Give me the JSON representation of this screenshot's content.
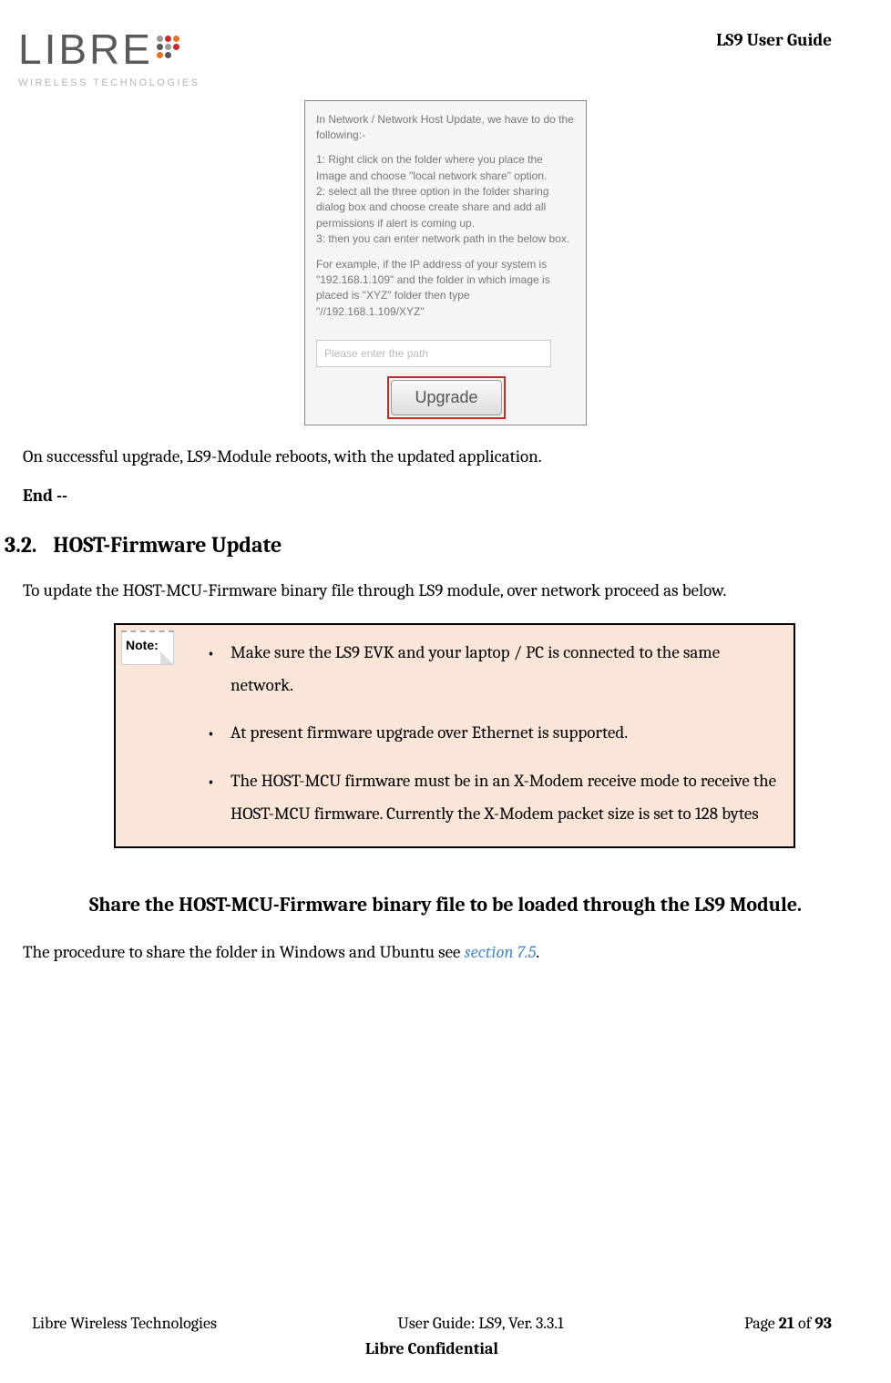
{
  "logo": {
    "text": "LIBRE",
    "subtitle": "WIRELESS TECHNOLOGIES"
  },
  "header": {
    "doc_title": "LS9 User Guide"
  },
  "dialog": {
    "intro": "In Network / Network Host Update, we have to do the following:-",
    "step1": "1: Right click on the folder where you place the Image and choose \"local network share\" option.",
    "step2": "2: select all the three option in the folder sharing dialog box and choose create share and add all permissions if alert is coming up.",
    "step3": "3: then you can enter network path in the below box.",
    "example": "For example, if the IP address of your system is \"192.168.1.109\" and the folder in which image is placed is \"XYZ\" folder then type \"//192.168.1.109/XYZ\"",
    "placeholder": "Please enter the path",
    "upgrade_button": "Upgrade"
  },
  "body": {
    "success_para": "On successful upgrade, LS9-Module reboots, with the updated application.",
    "end_label": "End --",
    "section_num": "3.2.",
    "section_title": "HOST-Firmware Update",
    "section_intro": "To update the HOST-MCU-Firmware binary file through LS9 module, over network proceed as below.",
    "note_label": "Note:",
    "notes": [
      "Make sure the LS9 EVK and your laptop / PC is connected to the same network.",
      "At present firmware upgrade over Ethernet is supported.",
      "The HOST-MCU firmware must be in an X-Modem receive mode to receive the HOST-MCU firmware. Currently the X-Modem packet size is set to 128 bytes"
    ],
    "share_heading": "Share the HOST-MCU-Firmware binary file to be loaded through the LS9 Module.",
    "share_para_prefix": "The procedure to share the folder in Windows and Ubuntu see ",
    "share_link": "section 7.5",
    "share_para_suffix": "."
  },
  "footer": {
    "left": "Libre Wireless Technologies",
    "center": "User Guide: LS9, Ver. 3.3.1",
    "right_prefix": "Page ",
    "page_current": "21",
    "right_mid": " of ",
    "page_total": "93",
    "line2": "Libre Confidential"
  }
}
